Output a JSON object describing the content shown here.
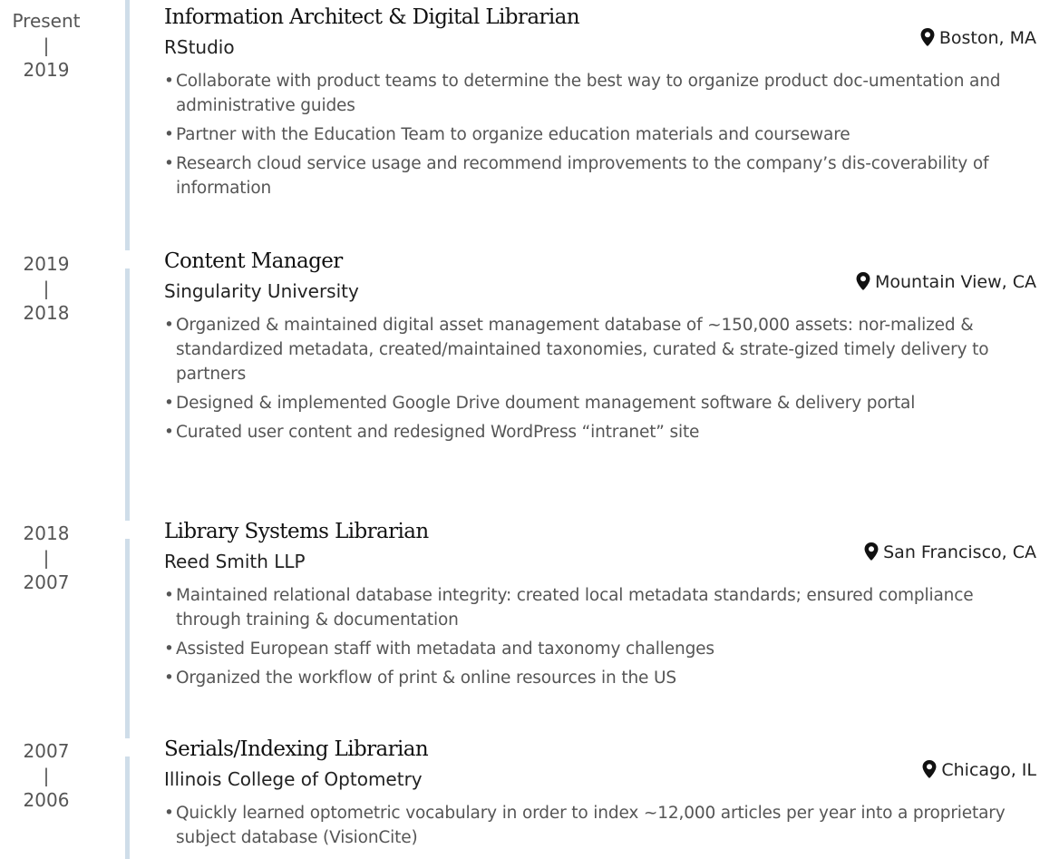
{
  "entries": [
    {
      "date_end": "Present",
      "date_sep": "|",
      "date_start": "2019",
      "title": "Information Architect & Digital Librarian",
      "company": "RStudio",
      "location": "Boston, MA",
      "bullets": [
        "Collaborate with product teams to determine the best way to organize product doc-umentation and administrative guides",
        "Partner with the Education Team to organize education materials and courseware",
        "Research cloud service usage and recommend improvements to the company’s dis-coverability of information"
      ]
    },
    {
      "date_end": "2019",
      "date_sep": "|",
      "date_start": "2018",
      "title": "Content Manager",
      "company": "Singularity University",
      "location": "Mountain View, CA",
      "bullets": [
        "Organized & maintained digital asset management database of ~150,000 assets: nor-malized & standardized metadata, created/maintained taxonomies, curated & strate-gized timely delivery to partners",
        "Designed & implemented Google Drive doument management software & delivery portal",
        "Curated user content and redesigned WordPress “intranet” site"
      ]
    },
    {
      "date_end": "2018",
      "date_sep": "|",
      "date_start": "2007",
      "title": "Library Systems Librarian",
      "company": "Reed Smith LLP",
      "location": "San Francisco, CA",
      "bullets": [
        "Maintained relational database integrity: created local metadata standards; ensured compliance through training & documentation",
        "Assisted European staff with metadata and taxonomy challenges",
        "Organized the workflow of print & online resources in the US"
      ]
    },
    {
      "date_end": "2007",
      "date_sep": "|",
      "date_start": "2006",
      "title": "Serials/Indexing Librarian",
      "company": "Illinois College of Optometry",
      "location": "Chicago, IL",
      "bullets": [
        "Quickly learned optometric vocabulary in order to index ~12,000 articles per year into a proprietary subject database (VisionCite)"
      ]
    }
  ],
  "icons": {
    "location": "map-marker-icon"
  },
  "colors": {
    "timeline": "#cfdde9",
    "title": "#111111",
    "body": "#555555"
  }
}
